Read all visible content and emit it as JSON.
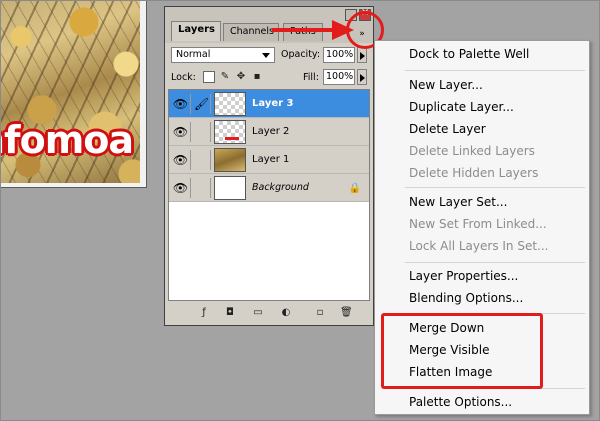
{
  "canvas": {
    "logo_text": "nfomoa"
  },
  "palette": {
    "tabs": [
      {
        "label": "Layers",
        "active": true
      },
      {
        "label": "Channels",
        "active": false
      },
      {
        "label": "Paths",
        "active": false
      }
    ],
    "menu_button": "»",
    "blend_mode": "Normal",
    "opacity_label": "Opacity:",
    "opacity_value": "100%",
    "lock_label": "Lock:",
    "fill_label": "Fill:",
    "fill_value": "100%",
    "layers": [
      {
        "name": "Layer 3",
        "selected": true,
        "thumb": "transparent"
      },
      {
        "name": "Layer 2",
        "selected": false,
        "thumb": "transparent-red"
      },
      {
        "name": "Layer 1",
        "selected": false,
        "thumb": "photo"
      },
      {
        "name": "Background",
        "selected": false,
        "thumb": "white",
        "locked": true
      }
    ],
    "icons": {
      "eye": "eye-icon",
      "brush": "brush-icon",
      "padlock": "padlock-icon"
    }
  },
  "menu": {
    "items": [
      {
        "label": "Dock to Palette Well",
        "enabled": true
      },
      {
        "label": "New Layer...",
        "enabled": true
      },
      {
        "label": "Duplicate Layer...",
        "enabled": true
      },
      {
        "label": "Delete Layer",
        "enabled": true
      },
      {
        "label": "Delete Linked Layers",
        "enabled": false
      },
      {
        "label": "Delete Hidden Layers",
        "enabled": false
      },
      {
        "label": "New Layer Set...",
        "enabled": true
      },
      {
        "label": "New Set From Linked...",
        "enabled": false
      },
      {
        "label": "Lock All Layers In Set...",
        "enabled": false
      },
      {
        "label": "Layer Properties...",
        "enabled": true
      },
      {
        "label": "Blending Options...",
        "enabled": true
      },
      {
        "label": "Merge Down",
        "enabled": true
      },
      {
        "label": "Merge Visible",
        "enabled": true
      },
      {
        "label": "Flatten Image",
        "enabled": true
      },
      {
        "label": "Palette Options...",
        "enabled": true
      }
    ]
  },
  "colors": {
    "annotation": "#e21b1b",
    "selection": "#3c8ce0"
  }
}
